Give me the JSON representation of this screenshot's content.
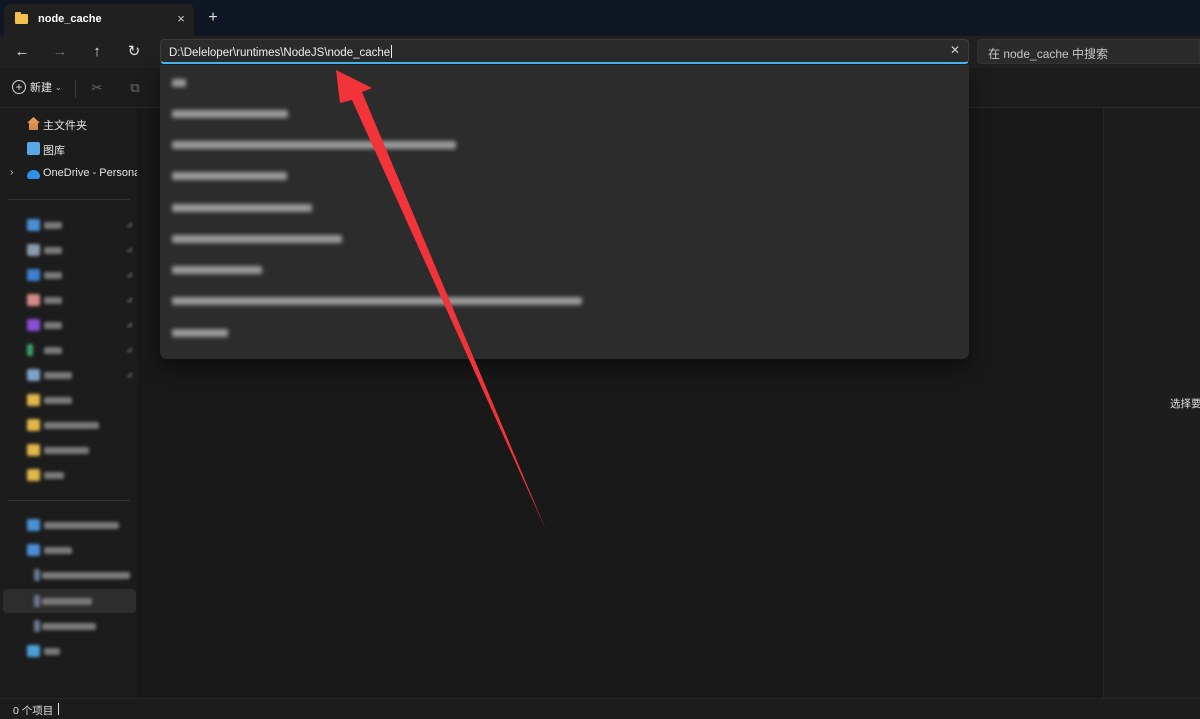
{
  "window": {
    "tab_title": "node_cache",
    "tab_close_icon": "×",
    "new_tab_icon": "+"
  },
  "nav": {
    "back_icon": "←",
    "forward_icon": "→",
    "up_icon": "↑",
    "refresh_icon": "↻",
    "address_value": "D:\\Deleloper\\runtimes\\NodeJS\\node_cache",
    "clear_icon": "✕",
    "search_placeholder": "在 node_cache 中搜索"
  },
  "toolbar": {
    "new_label": "新建",
    "new_chevron": "⌄",
    "cut_icon": "✂",
    "copy_icon": "⧉"
  },
  "sidebar": {
    "items": [
      {
        "label": "主文件夹",
        "icon": "home-icon"
      },
      {
        "label": "图库",
        "icon": "gallery-icon"
      },
      {
        "label": "OneDrive - Personal",
        "icon": "onedrive-icon"
      }
    ]
  },
  "details_pane": {
    "hint": "选择要"
  },
  "status": {
    "item_count": "0 个项目"
  },
  "colors": {
    "accent": "#4cc2ff",
    "annotation_arrow": "#f2333a",
    "folder": "#f2c04f"
  }
}
